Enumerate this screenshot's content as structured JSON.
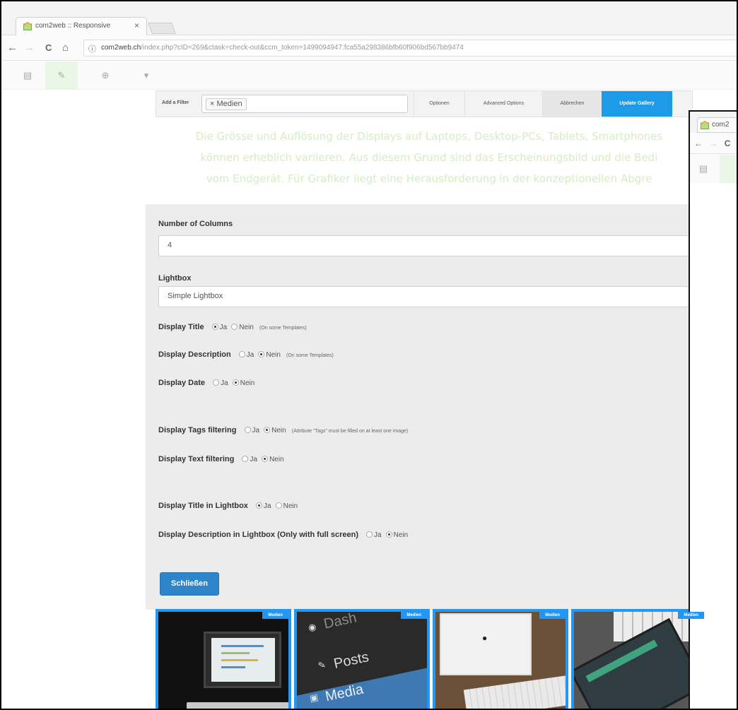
{
  "browser": {
    "tab_title": "com2web :: Responsive",
    "tab_close": "×",
    "url_domain": "com2web.ch",
    "url_path": "/index.php?cID=269&ctask=check-out&ccm_token=1499094947:fca55a298386bfb60f906bd567bb9474",
    "nav": {
      "back": "←",
      "forward": "→",
      "reload": "C",
      "home": "⌂",
      "info": "ⓘ"
    }
  },
  "editor_toolbar": {
    "page_icon": "▤",
    "pencil_icon": "✎",
    "add_icon": "⊕",
    "more_icon": "▾"
  },
  "gallery_bar": {
    "label": "Add a Filter",
    "chip": "× Medien",
    "options": "Optionen",
    "advanced": "Advanced Options",
    "cancel": "Abbrechen",
    "update": "Update Gallery"
  },
  "ghost_text": [
    "Die Grösse und Auflösung der Displays auf Laptops, Desktop-PCs, Tablets, Smartphones",
    "können erheblich variieren. Aus diesem Grund sind das Erscheinungsbild und die Bedi",
    "vom Endgerät. Für Grafiker liegt eine Herausforderung in der konzeptionellen Abgre"
  ],
  "settings": {
    "columns_label": "Number of Columns",
    "columns_value": "4",
    "lightbox_label": "Lightbox",
    "lightbox_value": "Simple Lightbox",
    "yes": "Ja",
    "no": "Nein",
    "display_title": {
      "label": "Display Title",
      "note": "(On some Templates)",
      "selected": "Ja"
    },
    "display_description": {
      "label": "Display Description",
      "note": "(On some Templates)",
      "selected": "Nein"
    },
    "display_date": {
      "label": "Display Date",
      "selected": "Nein"
    },
    "tags_filtering": {
      "label": "Display Tags filtering",
      "note": "(Attribute \"Tags\" must be filled on at least one image)",
      "selected": "Nein"
    },
    "text_filtering": {
      "label": "Display Text filtering",
      "selected": "Nein"
    },
    "title_lightbox": {
      "label": "Display Title in Lightbox",
      "selected": "Ja"
    },
    "desc_lightbox": {
      "label": "Display Description in Lightbox (Only with full screen)",
      "selected": "Nein"
    },
    "close_button": "Schließen"
  },
  "thumbnails": {
    "badge": "Medien",
    "items": [
      {
        "kind": "laptop"
      },
      {
        "kind": "wp-menu",
        "dash": "Dash",
        "posts": "Posts",
        "media": "Media"
      },
      {
        "kind": "imac"
      },
      {
        "kind": "tablet"
      }
    ]
  },
  "second_window": {
    "tab_title": "com2",
    "back": "←",
    "forward": "→",
    "reload": "C"
  },
  "colors": {
    "accent": "#1e9be8",
    "close_button": "#2f85c9",
    "thumb_border": "#2196f3",
    "ghost_text": "#d6edc4"
  }
}
